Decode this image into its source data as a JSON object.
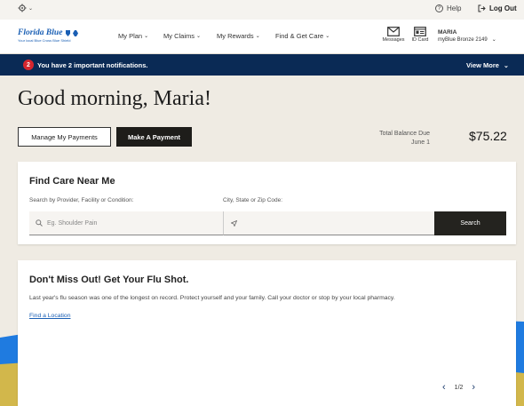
{
  "utility": {
    "help": "Help",
    "logout": "Log Out"
  },
  "nav": {
    "logo_title": "Florida Blue",
    "logo_sub": "Your local Blue Cross Blue Shield",
    "items": [
      {
        "label": "My Plan"
      },
      {
        "label": "My Claims"
      },
      {
        "label": "My Rewards"
      },
      {
        "label": "Find & Get Care"
      }
    ],
    "messages": "Messages",
    "id_card": "ID Card",
    "user_name": "MARIA",
    "user_plan": "myBlue Bronze 2149"
  },
  "notification": {
    "count": "2",
    "message": "You have 2 important notifications.",
    "view_more": "View More"
  },
  "greeting": "Good morning, Maria!",
  "payments": {
    "manage_label": "Manage My Payments",
    "make_label": "Make A Payment",
    "balance_label": "Total Balance Due",
    "due_date": "June 1",
    "amount": "$75.22"
  },
  "find_care": {
    "title": "Find Care Near Me",
    "provider_label": "Search by Provider, Facility or Condition:",
    "provider_placeholder": "Eg. Shoulder Pain",
    "location_label": "City, State or Zip Code:",
    "search_label": "Search"
  },
  "promo": {
    "title": "Don't Miss Out! Get Your Flu Shot.",
    "body": "Last year's flu season was one of the longest on record. Protect yourself and your family. Call your doctor or stop by your local pharmacy.",
    "link": "Find a Location",
    "pager": "1/2"
  },
  "colors": {
    "brand_blue": "#1a5fb4",
    "notification_bar": "#0a2a55",
    "badge_red": "#d7262e",
    "dark_button": "#1e1d1a",
    "background": "#efebe3"
  },
  "icons": [
    "gear-icon",
    "help-icon",
    "logout-icon",
    "messages-icon",
    "id-card-icon",
    "search-icon",
    "location-arrow-icon",
    "chevron-down-icon",
    "prev-arrow-icon",
    "next-arrow-icon"
  ]
}
